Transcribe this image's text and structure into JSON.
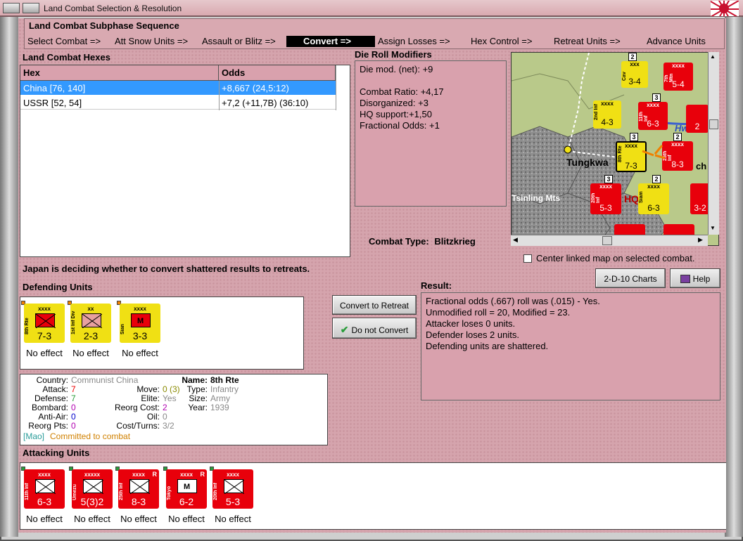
{
  "window": {
    "title": "Land Combat Selection & Resolution"
  },
  "subphase": {
    "heading": "Land Combat Subphase Sequence",
    "steps": [
      "Select Combat =>",
      "Att Snow Units =>",
      "Assault or Blitz =>",
      "Convert =>",
      "Assign Losses =>",
      "Hex Control =>",
      "Retreat Units =>",
      "Advance Units"
    ]
  },
  "hexes": {
    "label": "Land Combat Hexes",
    "col_hex": "Hex",
    "col_odds": "Odds",
    "rows": [
      {
        "hex": "China [76, 140]",
        "odds": "+8,667 (24,5:12)"
      },
      {
        "hex": "USSR [52, 54]",
        "odds": "+7,2 (+11,7B) (36:10)"
      }
    ]
  },
  "modifiers": {
    "label": "Die Roll Modifiers",
    "net": "Die mod. (net): +9",
    "lines": [
      "Combat Ratio: +4,17",
      "Disorganized: +3",
      "HQ support:+1,50",
      "Fractional Odds: +1"
    ]
  },
  "combat_type": {
    "label": "Combat Type:",
    "value": "Blitzkrieg"
  },
  "map": {
    "labels": [
      "Tungkwa",
      "Tsinling Mts",
      "HQ",
      "Hw",
      "ch"
    ],
    "checkbox_label": "Center linked map on selected combat.",
    "counters": [
      {
        "name": "Cav",
        "size": "xxx",
        "str": "3-4",
        "color": "yellow"
      },
      {
        "name": "7th Mtn",
        "size": "xxxx",
        "str": "5-4",
        "color": "red"
      },
      {
        "name": "2nd Inf",
        "size": "xxxx",
        "str": "4-3",
        "color": "yellow"
      },
      {
        "name": "11th Inf",
        "size": "xxxx",
        "str": "6-3",
        "color": "red"
      },
      {
        "name": "8th Rte",
        "size": "xxxx",
        "str": "7-3",
        "color": "yellow"
      },
      {
        "name": "25th Inf",
        "size": "xxxx",
        "str": "8-3",
        "color": "red"
      },
      {
        "name": "20th Inf",
        "size": "xxxx",
        "str": "5-3",
        "color": "red"
      },
      {
        "name": "Siam",
        "size": "xxxx",
        "str": "6-3",
        "color": "yellow"
      },
      {
        "name": "",
        "size": "",
        "str": "2",
        "color": "red"
      },
      {
        "name": "",
        "size": "",
        "str": "3-2",
        "color": "red"
      }
    ],
    "stack_badges": [
      "2",
      "3",
      "3",
      "2",
      "3",
      "2"
    ]
  },
  "status": "Japan is deciding whether to convert shattered results to retreats.",
  "buttons": {
    "charts": "2-D-10 Charts",
    "help": "Help",
    "convert": "Convert to Retreat",
    "no_convert": "Do not Convert"
  },
  "defending": {
    "label": "Defending Units",
    "units": [
      {
        "name": "8th Rte",
        "size": "xxxx",
        "str": "7-3",
        "effect": "No effect",
        "color": "yellow",
        "sym_fill": "#e8000b",
        "mark": ""
      },
      {
        "name": "1st Inf Div",
        "size": "xx",
        "str": "2-3",
        "effect": "No effect",
        "color": "yellow",
        "sym_fill": "#e8a0a0",
        "mark": ""
      },
      {
        "name": "Sian",
        "size": "xxxx",
        "str": "3-3",
        "effect": "No effect",
        "color": "yellow",
        "sym_fill": "#e8000b",
        "mark": "M"
      }
    ]
  },
  "info": {
    "country_l": "Country:",
    "country_v": "Communist China",
    "attack_l": "Attack:",
    "attack_v": "7",
    "defense_l": "Defense:",
    "defense_v": "7",
    "bombard_l": "Bombard:",
    "bombard_v": "0",
    "aa_l": "Anti-Air:",
    "aa_v": "0",
    "reorg_l": "Reorg Pts:",
    "reorg_v": "0",
    "move_l": "Move:",
    "move_v": "0 (3)",
    "elite_l": "Elite:",
    "elite_v": "Yes",
    "reorgcost_l": "Reorg Cost:",
    "reorgcost_v": "2",
    "oil_l": "Oil:",
    "oil_v": "0",
    "cost_l": "Cost/Turns:",
    "cost_v": "3/2",
    "name_l": "Name:",
    "name_v": "8th Rte",
    "type_l": "Type:",
    "type_v": "Infantry",
    "sz_l": "Size:",
    "sz_v": "Army",
    "year_l": "Year:",
    "year_v": "1939",
    "leader": "[Mao]",
    "committed": "Committed to combat"
  },
  "result": {
    "label": "Result:",
    "lines": [
      "Fractional odds (.667) roll was (.015)  - Yes.",
      "Unmodified roll = 20, Modified = 23.",
      "Attacker loses 0 units.",
      "Defender loses 2 units.",
      "Defending units are shattered."
    ]
  },
  "attacking": {
    "label": "Attacking Units",
    "units": [
      {
        "name": "11th Inf",
        "size": "xxxx",
        "str": "6-3",
        "effect": "No effect",
        "r": "",
        "mark": ""
      },
      {
        "name": "Umezu",
        "size": "xxxxx",
        "str": "5(3)2",
        "effect": "No effect",
        "r": "",
        "mark": ""
      },
      {
        "name": "25th Inf",
        "size": "xxxx",
        "str": "8-3",
        "effect": "No effect",
        "r": "R",
        "mark": ""
      },
      {
        "name": "Tokyo",
        "size": "xxxx",
        "str": "6-2",
        "effect": "No effect",
        "r": "R",
        "mark": "M"
      },
      {
        "name": "20th Inf",
        "size": "xxxx",
        "str": "5-3",
        "effect": "No effect",
        "r": "",
        "mark": ""
      }
    ]
  },
  "colors": {
    "pink_panel": "#d9a1ad",
    "selection": "#3399ff",
    "unit_red": "#e8000b",
    "unit_yellow": "#f0e014"
  }
}
